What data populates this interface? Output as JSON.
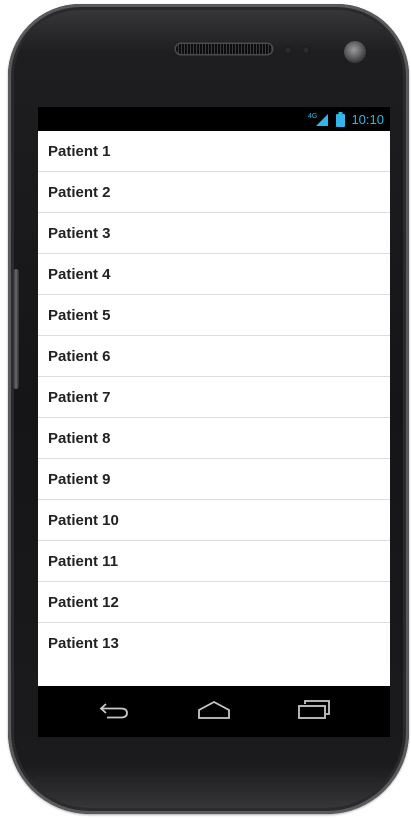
{
  "status_bar": {
    "network": "4G",
    "time": "10:10",
    "accent_color": "#33b5e5",
    "icons": [
      "signal-4g-icon",
      "battery-icon"
    ]
  },
  "list": {
    "items": [
      {
        "label": "Patient 1"
      },
      {
        "label": "Patient 2"
      },
      {
        "label": "Patient 3"
      },
      {
        "label": "Patient 4"
      },
      {
        "label": "Patient 5"
      },
      {
        "label": "Patient 6"
      },
      {
        "label": "Patient 7"
      },
      {
        "label": "Patient 8"
      },
      {
        "label": "Patient 9"
      },
      {
        "label": "Patient 10"
      },
      {
        "label": "Patient 11"
      },
      {
        "label": "Patient 12"
      },
      {
        "label": "Patient 13"
      }
    ]
  },
  "nav_bar": {
    "buttons": [
      "back-icon",
      "home-icon",
      "recent-apps-icon"
    ]
  }
}
